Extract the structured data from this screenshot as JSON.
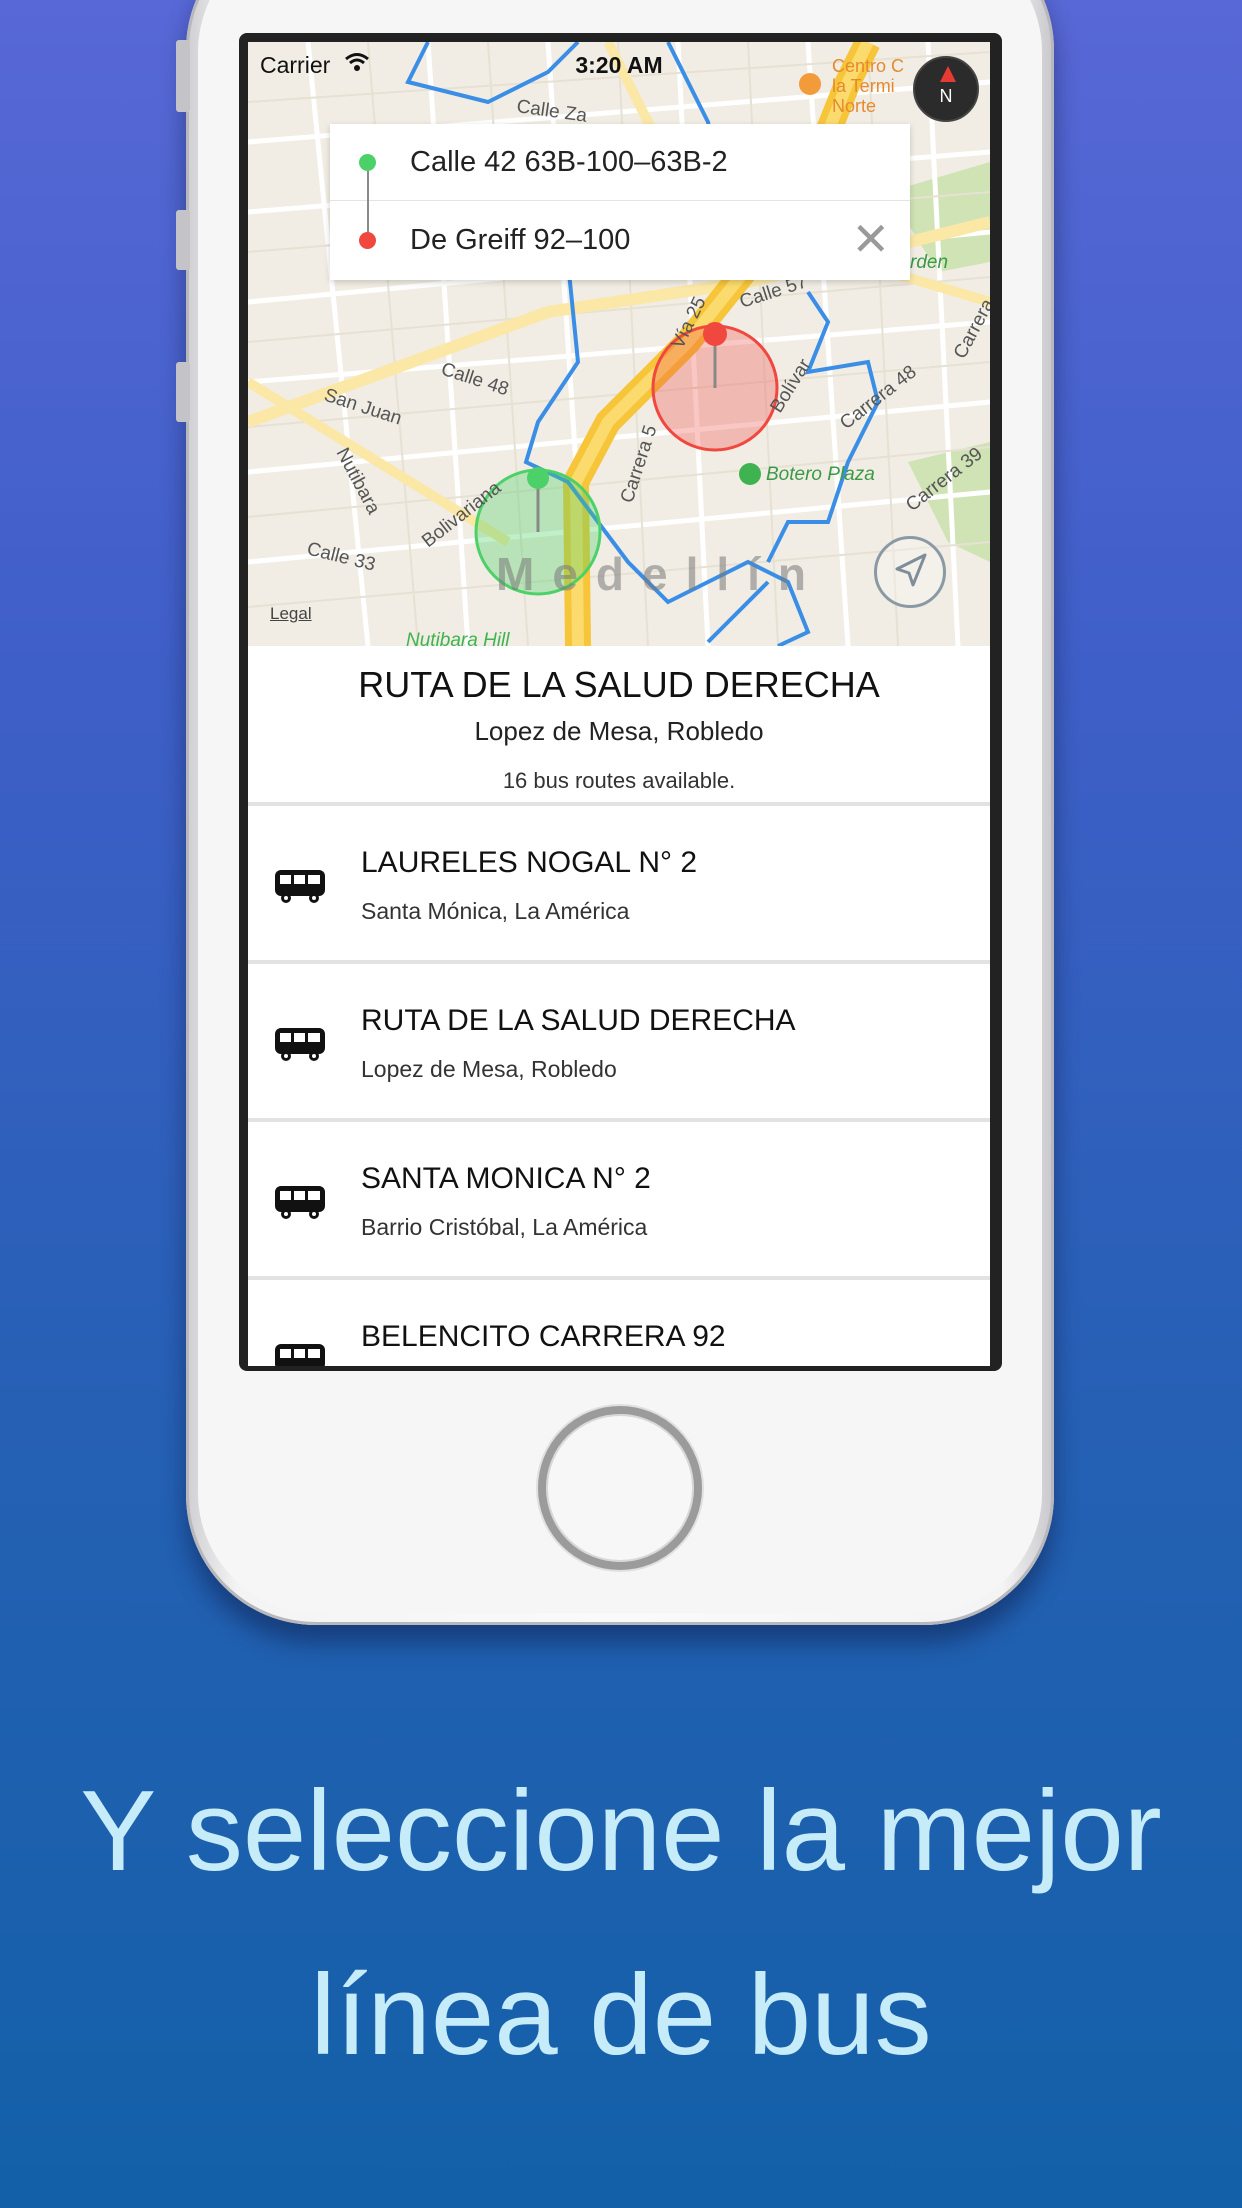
{
  "status_bar": {
    "carrier": "Carrier",
    "time": "3:20 AM"
  },
  "search": {
    "origin": "Calle 42 63B-100–63B-2",
    "destination": "De Greiff 92–100",
    "clear_icon": "close-icon"
  },
  "map": {
    "legal": "Legal",
    "city": "Medellín",
    "compass_label": "N",
    "labels": {
      "calle48": "Calle 48",
      "san_juan": "San Juan",
      "nutibara": "Nutibara",
      "calle33": "Calle 33",
      "bolivariana": "Bolivariana",
      "carrera": "Carrera 5",
      "via25": "Vía 25",
      "calle57": "Calle 57",
      "bolivar": "Bolívar",
      "carrera48": "Carrera 48",
      "carrera39": "Carrera 39",
      "carrera_r": "Carrera",
      "botero": "Botero Plaza",
      "centro": "Centro C",
      "la_termi": "la Termi",
      "norte": "Norte",
      "calle_za": "Calle Za",
      "rden": "rden",
      "nutibara_hill": "Nutibara Hill"
    },
    "colors": {
      "origin": "#4cd168",
      "destination": "#f0473f",
      "route": "#3a8ee6",
      "highway": "#f6c53a"
    }
  },
  "route": {
    "title": "RUTA DE LA SALUD DERECHA",
    "subtitle": "Lopez de Mesa, Robledo",
    "count": "16 bus routes available."
  },
  "routes": [
    {
      "name": "LAURELES NOGAL N° 2",
      "via": "Santa Mónica, La América"
    },
    {
      "name": "RUTA DE LA SALUD DERECHA",
      "via": "Lopez de Mesa, Robledo"
    },
    {
      "name": "SANTA MONICA N° 2",
      "via": "Barrio Cristóbal, La América"
    },
    {
      "name": "BELENCITO CARRERA 92",
      "via": ""
    }
  ],
  "caption": {
    "line1": "Y seleccione la mejor",
    "line2": "línea de bus"
  }
}
